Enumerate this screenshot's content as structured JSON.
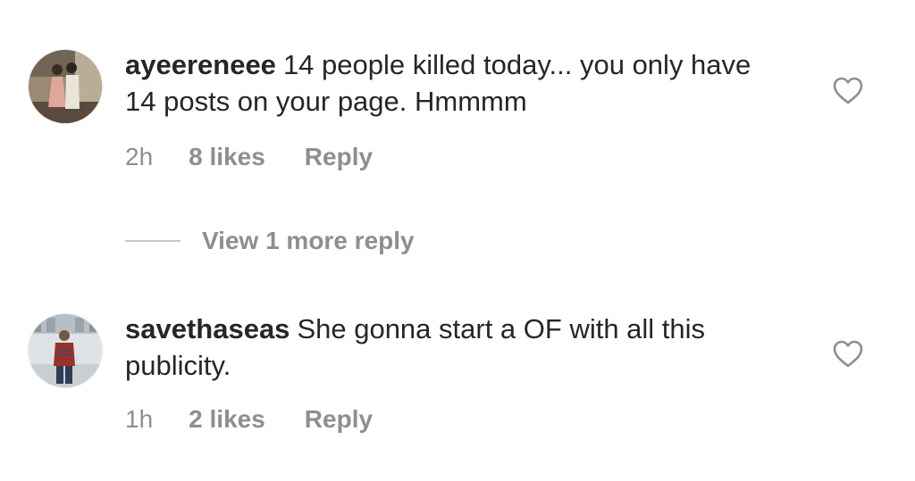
{
  "comments": [
    {
      "username": "ayeereneee",
      "text": "14 people killed today... you only have 14 posts on your page. Hmmmm",
      "time": "2h",
      "likes": "8 likes",
      "reply_label": "Reply",
      "avatar_icon": "profile-photo-couple",
      "heart_icon": "heart-outline-icon"
    },
    {
      "username": "savethaseas",
      "text": "She gonna start a OF with all this publicity.",
      "time": "1h",
      "likes": "2 likes",
      "reply_label": "Reply",
      "avatar_icon": "profile-photo-person",
      "heart_icon": "heart-outline-icon"
    }
  ],
  "view_more_replies": "View 1 more reply",
  "colors": {
    "text": "#262626",
    "secondary": "#8e8e8e",
    "divider": "#c7c7c7",
    "background": "#ffffff"
  }
}
